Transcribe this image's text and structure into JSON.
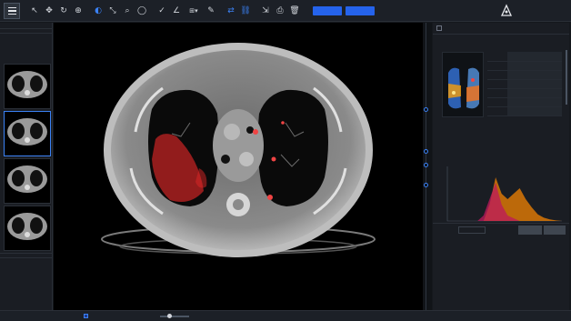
{
  "toolbar": {
    "tools": [
      {
        "name": "pointer-icon",
        "glyph": "↖",
        "active": false
      },
      {
        "name": "pan-icon",
        "glyph": "✥",
        "active": false
      },
      {
        "name": "rotate-icon",
        "glyph": "↻",
        "active": false
      },
      {
        "name": "zoom-icon",
        "glyph": "⊕",
        "active": false
      },
      {
        "name": "window-level-icon",
        "glyph": "◐",
        "active": true
      },
      {
        "name": "measure-icon",
        "glyph": "⤡",
        "active": false
      },
      {
        "name": "magnify-icon",
        "glyph": "⌕",
        "active": false
      },
      {
        "name": "ellipse-roi-icon",
        "glyph": "◯",
        "active": false
      },
      {
        "name": "check-icon",
        "glyph": "✓",
        "active": false
      },
      {
        "name": "angle-icon",
        "glyph": "∠",
        "active": false
      },
      {
        "name": "layout-dropdown-icon",
        "glyph": "⊞▾",
        "active": false
      },
      {
        "name": "pen-icon",
        "glyph": "✎",
        "active": false
      },
      {
        "name": "sync-icon",
        "glyph": "⇄",
        "active": true
      },
      {
        "name": "link-icon",
        "glyph": "⛓",
        "active": true
      },
      {
        "name": "export-icon",
        "glyph": "⇲",
        "active": false
      },
      {
        "name": "screenshot-icon",
        "glyph": "⎙",
        "active": false
      },
      {
        "name": "delete-icon",
        "glyph": "🗑",
        "active": false
      }
    ],
    "btn_primary_label": "",
    "btn_secondary_label": "",
    "brand_line1": "",
    "brand_line2": ""
  },
  "left_panel": {
    "patient_lines": [
      "",
      ""
    ],
    "series_note_lines": [
      "",
      ""
    ],
    "series_note2_lines": [
      "",
      ""
    ],
    "thumbnails": [
      {
        "caption": "",
        "selected": false
      },
      {
        "caption": "",
        "selected": true
      },
      {
        "caption": "",
        "selected": false
      },
      {
        "caption": "",
        "selected": false
      }
    ]
  },
  "viewer": {
    "readout_line1": "",
    "readout_line2": ""
  },
  "analysis": {
    "title": "",
    "warning": "",
    "section1_title": "",
    "lung_figure_label": "",
    "stats": [
      {
        "k": "",
        "v": ""
      },
      {
        "k": "",
        "v": ""
      },
      {
        "k": "",
        "v": ""
      },
      {
        "k": "",
        "v": ""
      },
      {
        "k": "",
        "v": ""
      },
      {
        "k": "",
        "v": ""
      },
      {
        "k": "",
        "v": ""
      }
    ],
    "density_title": "",
    "density_right": "",
    "legend": [
      {
        "name": "",
        "value": "",
        "color": "#ef4444"
      },
      {
        "name": "",
        "value": "",
        "color": "#f59e0b"
      },
      {
        "name": "",
        "value": "",
        "color": "#eab308"
      },
      {
        "name": "",
        "value": "",
        "color": "#e5e7eb"
      },
      {
        "name": "",
        "value": "",
        "color": "#a855f7"
      }
    ],
    "report_label": "",
    "report_select": "",
    "report_help": "",
    "report_btn1": "",
    "report_btn2": "",
    "report_text": "",
    "footer": ""
  },
  "chart_data": {
    "type": "area",
    "title": "",
    "xlabel": "",
    "ylabel": "",
    "series": [
      {
        "values": [
          0,
          0,
          0,
          0,
          0,
          0,
          0,
          0.3,
          0.8,
          0.5,
          0.4,
          0.5,
          0.6,
          0.4,
          0.25,
          0.12,
          0.06,
          0.03,
          0.01,
          0
        ],
        "color": "#d97706"
      },
      {
        "values": [
          0,
          0,
          0,
          0,
          0,
          0,
          0.1,
          0.4,
          0.7,
          0.3,
          0.1,
          0.05,
          0,
          0,
          0,
          0,
          0,
          0,
          0,
          0
        ],
        "color": "#be185d"
      }
    ]
  },
  "statusbar": {
    "left": "",
    "sync_label": "",
    "thickness_label": "",
    "right": ""
  }
}
